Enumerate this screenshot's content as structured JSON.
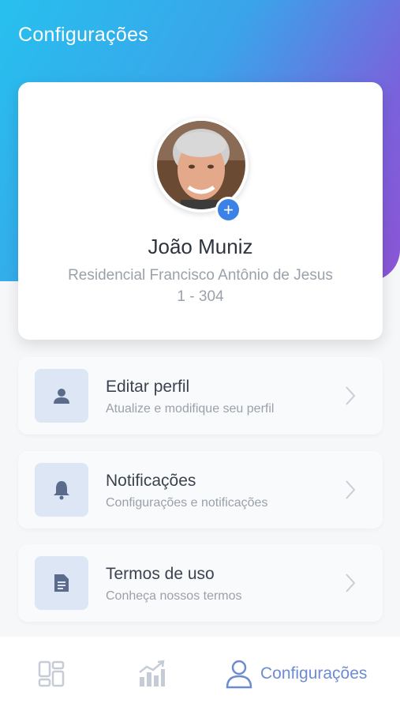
{
  "header": {
    "title": "Configurações"
  },
  "profile": {
    "name": "João Muniz",
    "address": "Residencial Francisco Antônio de Jesus",
    "unit": "1 - 304",
    "add_icon": "+"
  },
  "menu": [
    {
      "title": "Editar perfil",
      "subtitle": "Atualize e modifique seu perfil",
      "icon": "person-icon"
    },
    {
      "title": "Notificações",
      "subtitle": "Configurações e notificações",
      "icon": "bell-icon"
    },
    {
      "title": "Termos de uso",
      "subtitle": "Conheça nossos termos",
      "icon": "document-icon"
    }
  ],
  "nav": {
    "items": [
      {
        "icon": "dashboard-icon"
      },
      {
        "icon": "chart-icon"
      },
      {
        "icon": "user-icon",
        "label": "Configurações",
        "active": true
      }
    ]
  },
  "colors": {
    "gradient_start": "#27c0ee",
    "gradient_end": "#8b55d6",
    "accent": "#6d8bd1",
    "badge": "#3c82e6"
  }
}
